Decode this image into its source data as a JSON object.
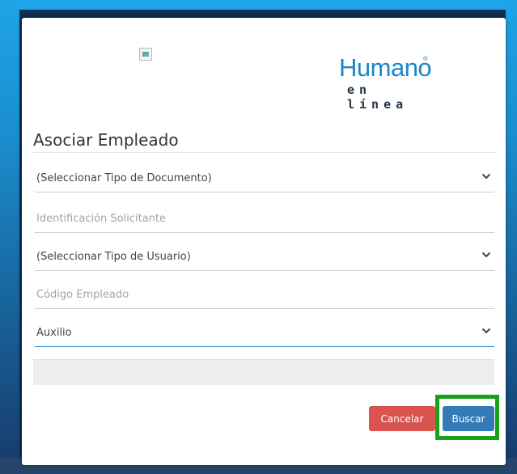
{
  "logo": {
    "main": "Humano",
    "reg": "®",
    "sub": "en línea"
  },
  "form": {
    "title": "Asociar Empleado",
    "fields": [
      {
        "type": "select",
        "value": "(Seleccionar Tipo de Documento)"
      },
      {
        "type": "input",
        "placeholder": "Identificación Solicitante"
      },
      {
        "type": "select",
        "value": "(Seleccionar Tipo de Usuario)"
      },
      {
        "type": "input",
        "placeholder": "Código Empleado"
      },
      {
        "type": "select",
        "value": "Auxilio"
      }
    ]
  },
  "buttons": {
    "cancel": "Cancelar",
    "search": "Buscar"
  },
  "colors": {
    "cancel": "#d9534f",
    "search": "#337ab7",
    "highlight": "#1aa11a",
    "logo": "#1d86c9"
  }
}
